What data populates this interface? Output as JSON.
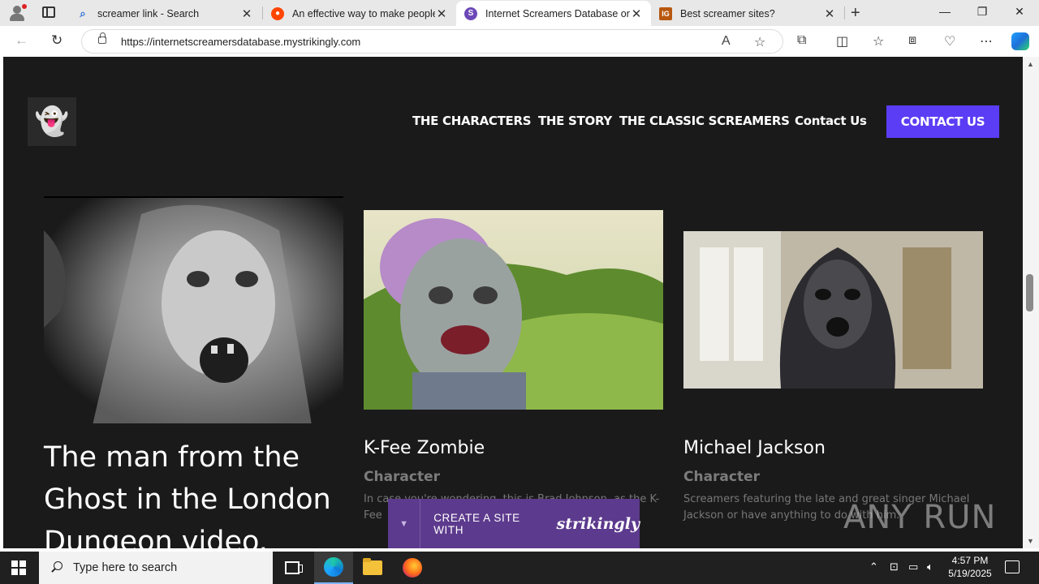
{
  "browser": {
    "tabs": [
      {
        "title": "screamer link - Search",
        "favicon": "search-icon",
        "color": "#2b6fd6"
      },
      {
        "title": "An effective way to make people",
        "favicon": "reddit-icon",
        "color": "#ff4500"
      },
      {
        "title": "Internet Screamers Database on S",
        "favicon": "strikingly-icon",
        "color": "#6c48b8"
      },
      {
        "title": "Best screamer sites?",
        "favicon": "ig-icon",
        "color": "#b8570f"
      }
    ],
    "new_tab": "+",
    "window": {
      "minimize": "—",
      "restore": "❐",
      "close": "✕"
    },
    "url": "https://internetscreamersdatabase.mystrikingly.com"
  },
  "site": {
    "logo_glyph": "👻",
    "nav": [
      "THE CHARACTERS",
      "THE STORY",
      "THE CLASSIC SCREAMERS",
      "Contact Us"
    ],
    "cta": "CONTACT US",
    "cta_color": "#5b3df5",
    "cards": [
      {
        "title": "The man from the Ghost in the London Dungeon video.",
        "subtitle": "",
        "description": ""
      },
      {
        "title": "K-Fee Zombie",
        "subtitle": "Character",
        "description": "In case you're wondering, this is Brad Johnson, as the K-Fee"
      },
      {
        "title": "Michael Jackson",
        "subtitle": "Character",
        "description": "Screamers featuring the late and great singer Michael Jackson or have anything to do with him."
      }
    ],
    "banner": {
      "text": "CREATE A SITE WITH",
      "brand": "strikingly",
      "color": "#5c3a8d"
    }
  },
  "watermark": "ANY RUN",
  "taskbar": {
    "search_placeholder": "Type here to search",
    "time": "4:57 PM",
    "date": "5/19/2025"
  }
}
